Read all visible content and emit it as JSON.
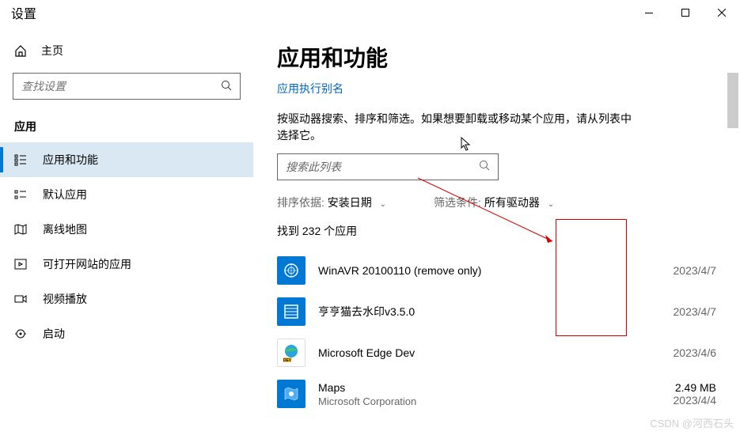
{
  "titlebar": {
    "title": "设置"
  },
  "sidebar": {
    "home": "主页",
    "search_placeholder": "查找设置",
    "section": "应用",
    "items": [
      {
        "label": "应用和功能"
      },
      {
        "label": "默认应用"
      },
      {
        "label": "离线地图"
      },
      {
        "label": "可打开网站的应用"
      },
      {
        "label": "视频播放"
      },
      {
        "label": "启动"
      }
    ]
  },
  "content": {
    "title": "应用和功能",
    "link": "应用执行别名",
    "desc": "按驱动器搜索、排序和筛选。如果想要卸载或移动某个应用，请从列表中选择它。",
    "search_placeholder": "搜索此列表",
    "sort_label": "排序依据:",
    "sort_value": "安装日期",
    "filter_label": "筛选条件:",
    "filter_value": "所有驱动器",
    "count": "找到 232 个应用",
    "apps": [
      {
        "name": "WinAVR 20100110 (remove only)",
        "publisher": "",
        "size": "",
        "date": "2023/4/7"
      },
      {
        "name": "亨亨猫去水印v3.5.0",
        "publisher": "",
        "size": "",
        "date": "2023/4/7"
      },
      {
        "name": "Microsoft Edge Dev",
        "publisher": "",
        "size": "",
        "date": "2023/4/6"
      },
      {
        "name": "Maps",
        "publisher": "Microsoft Corporation",
        "size": "2.49 MB",
        "date": "2023/4/4"
      }
    ]
  },
  "watermark": "CSDN @河西石头"
}
